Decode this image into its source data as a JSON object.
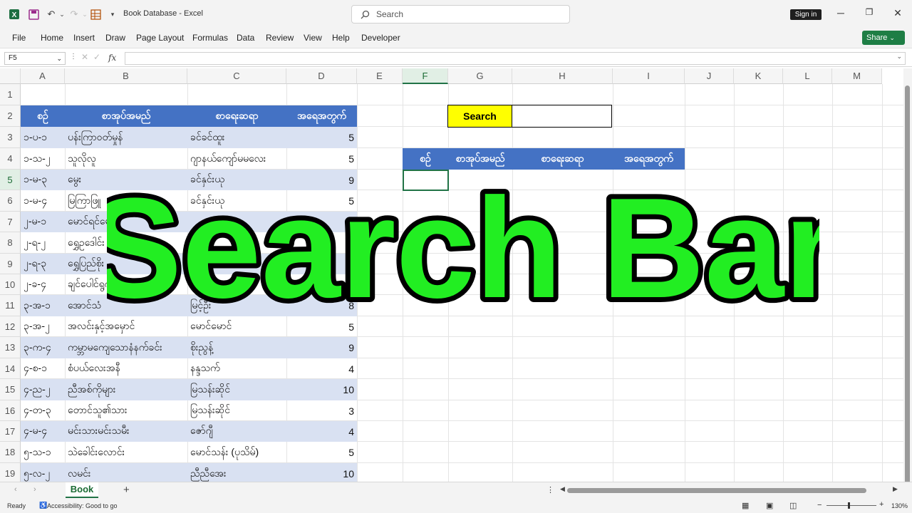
{
  "app": {
    "title": "Book Database  -  Excel",
    "search_placeholder": "Search",
    "signin": "Sign in",
    "share": "Share"
  },
  "ribbon_tabs": [
    "File",
    "Home",
    "Insert",
    "Draw",
    "Page Layout",
    "Formulas",
    "Data",
    "Review",
    "View",
    "Help",
    "Developer"
  ],
  "formula": {
    "namebox": "F5",
    "fx": "fx",
    "value": ""
  },
  "columns": [
    "A",
    "B",
    "C",
    "D",
    "E",
    "F",
    "G",
    "H",
    "I",
    "J",
    "K",
    "L",
    "M"
  ],
  "rows": [
    "1",
    "2",
    "3",
    "4",
    "5",
    "6",
    "7",
    "8",
    "9",
    "10",
    "11",
    "12",
    "13",
    "14",
    "15",
    "16",
    "17",
    "18",
    "19"
  ],
  "table": {
    "headers": [
      "စဥ်",
      "စာအုပ်အမည်",
      "စာရေးဆရာ",
      "အရေအတွက်"
    ],
    "rows": [
      [
        "၁-ပ-၁",
        "ပန်းကြာဝတ်မှုန်",
        "ခင်ခင်ထူး",
        "5"
      ],
      [
        "၁-သ-၂",
        "သူလိုလူ",
        "ဂျာနယ်ကျော်မမလေး",
        "5"
      ],
      [
        "၁-မ-၃",
        "မွေး",
        "ခင်နှင်းယု",
        "9"
      ],
      [
        "၁-မ-၄",
        "မြကြာဖြူ",
        "ခင်နှင်းယု",
        "5"
      ],
      [
        "၂-မ-၁",
        "မောင်ရင်မောင်",
        "",
        "8"
      ],
      [
        "၂-ရ-၂",
        "ရွှေဥဒေါင်း",
        "",
        ""
      ],
      [
        "၂-ရ-၃",
        "ရွှေပြည်စိုး",
        "",
        ""
      ],
      [
        "၂-ခ-၄",
        "ချင်ပေါင်ရွက်",
        "",
        ""
      ],
      [
        "၃-အ-၁",
        "အောင်သံ",
        "မြင့်ဦး",
        "8"
      ],
      [
        "၃-အ-၂",
        "အလင်းနှင့်အမှောင်",
        "မောင်မောင်",
        "5"
      ],
      [
        "၃-က-၄",
        "ကမ္ဘာမကျေသောနံနက်ခင်း",
        "စိုးညွန့်",
        "9"
      ],
      [
        "၄-စ-၁",
        "စံပယ်လေးအနီ",
        "နန္ဒသက်",
        "4"
      ],
      [
        "၄-ည-၂",
        "ညီအစ်ကိုများ",
        "မြသန်းဆိုင်",
        "10"
      ],
      [
        "၄-တ-၃",
        "တောင်သူ၏သား",
        "မြသန်းဆိုင်",
        "3"
      ],
      [
        "၄-မ-၄",
        "မင်းသားမင်းသမီး",
        "ဇော်ဂျီ",
        "4"
      ],
      [
        "၅-သ-၁",
        "သဲခေါင်းလောင်း",
        "မောင်သန်း (ပုသိမ်)",
        "5"
      ],
      [
        "၅-လ-၂",
        "လမင်း",
        "ညီညီအေး",
        "10"
      ]
    ]
  },
  "search_panel": {
    "label": "Search",
    "value": "",
    "headers": [
      "စဥ်",
      "စာအုပ်အမည်",
      "စာရေးဆရာ",
      "အရေအတွက်"
    ]
  },
  "overlay_text": "Search Bar",
  "sheet_tab": "Book",
  "status": {
    "ready": "Ready",
    "accessibility": "Accessibility: Good to go",
    "zoom": "130%"
  },
  "colors": {
    "header_blue": "#4472c4",
    "band": "#d9e1f2",
    "accent_green": "#217346",
    "overlay_green": "#22ee22"
  }
}
